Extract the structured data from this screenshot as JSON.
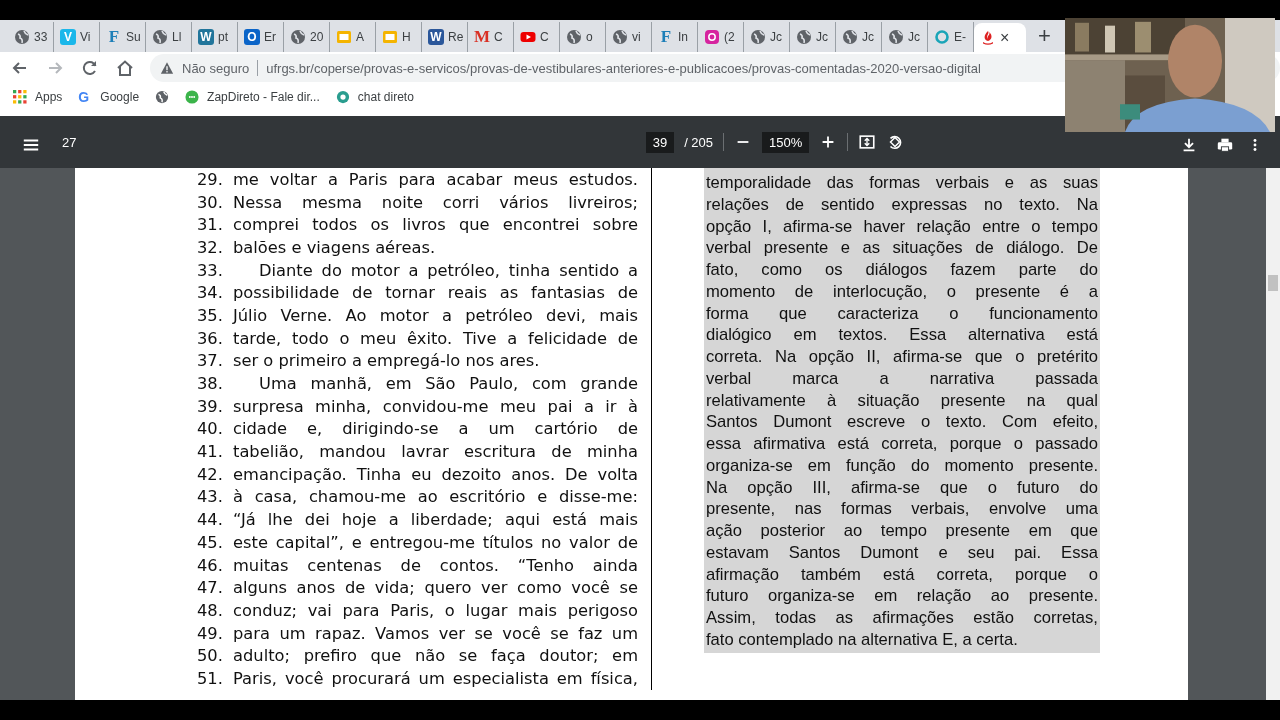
{
  "tabs": [
    {
      "kind": "globe",
      "title": "33",
      "selected": false
    },
    {
      "kind": "badge",
      "glyph": "V",
      "color": "#1ab7ea",
      "title": "Vi",
      "selected": false
    },
    {
      "kind": "letter",
      "glyph": "F",
      "color": "#1d7fb8",
      "title": "Su",
      "selected": false
    },
    {
      "kind": "globe",
      "title": "Ll",
      "selected": false
    },
    {
      "kind": "badge",
      "glyph": "W",
      "color": "#21759b",
      "title": "pt",
      "selected": false
    },
    {
      "kind": "badge",
      "glyph": "O",
      "color": "#0a64c8",
      "title": "Er",
      "selected": false
    },
    {
      "kind": "globe",
      "title": "20",
      "selected": false
    },
    {
      "kind": "slides",
      "title": "A",
      "selected": false
    },
    {
      "kind": "slides",
      "title": "H",
      "selected": false
    },
    {
      "kind": "badge",
      "glyph": "W",
      "color": "#2b579a",
      "title": "Re",
      "selected": false
    },
    {
      "kind": "letter",
      "glyph": "M",
      "color": "#d93025",
      "title": "C",
      "selected": false
    },
    {
      "kind": "youtube",
      "title": "C",
      "selected": false
    },
    {
      "kind": "globe",
      "title": "o",
      "selected": false
    },
    {
      "kind": "globe",
      "title": "vi",
      "selected": false
    },
    {
      "kind": "letter",
      "glyph": "F",
      "color": "#1d7fb8",
      "title": "In",
      "selected": false
    },
    {
      "kind": "instagram",
      "title": "(2",
      "selected": false
    },
    {
      "kind": "globe",
      "title": "Jc",
      "selected": false
    },
    {
      "kind": "globe",
      "title": "Jc",
      "selected": false
    },
    {
      "kind": "globe",
      "title": "Jc",
      "selected": false
    },
    {
      "kind": "globe",
      "title": "Jc",
      "selected": false
    },
    {
      "kind": "ring",
      "title": "E-",
      "selected": false
    },
    {
      "kind": "flame",
      "selected": true,
      "close": "×"
    }
  ],
  "new_tab": "+",
  "address": {
    "warning": "Não seguro",
    "url": "ufrgs.br/coperse/provas-e-servicos/provas-de-vestibulares-anteriores-e-publicacoes/provas-comentadas-2020-versao-digital"
  },
  "bookmarks": [
    {
      "kind": "apps",
      "label": "Apps"
    },
    {
      "kind": "google",
      "glyph": "G",
      "label": "Google"
    },
    {
      "kind": "globe"
    },
    {
      "kind": "zap",
      "label": "ZapDireto - Fale dir..."
    },
    {
      "kind": "chat",
      "label": "chat direto"
    }
  ],
  "pdf_toolbar": {
    "title": "27",
    "page": "39",
    "total": "/ 205",
    "zoom": "150%"
  },
  "left_column": [
    {
      "n": "29.",
      "text": "me voltar a Paris para acabar meus estudos.",
      "kind": "full"
    },
    {
      "n": "30.",
      "text": "Nessa mesma noite corri vários livreiros;",
      "kind": "full"
    },
    {
      "n": "31.",
      "text": "comprei todos os livros que encontrei sobre",
      "kind": "full"
    },
    {
      "n": "32.",
      "text": "balões e viagens aéreas.",
      "kind": "end"
    },
    {
      "n": "33.",
      "text": "Diante do motor a petróleo, tinha sentido a",
      "kind": "start"
    },
    {
      "n": "34.",
      "text": "possibilidade de tornar reais as fantasias de",
      "kind": "full"
    },
    {
      "n": "35.",
      "text": "Júlio Verne. Ao motor a petróleo devi, mais",
      "kind": "full"
    },
    {
      "n": "36.",
      "text": "tarde, todo o meu êxito. Tive a felicidade de",
      "kind": "full"
    },
    {
      "n": "37.",
      "text": "ser o primeiro a empregá-lo nos ares.",
      "kind": "end"
    },
    {
      "n": "38.",
      "text": "Uma manhã, em São Paulo, com grande",
      "kind": "start"
    },
    {
      "n": "39.",
      "text": "surpresa minha, convidou-me meu pai a ir à",
      "kind": "full"
    },
    {
      "n": "40.",
      "text": "cidade e, dirigindo-se a um cartório de",
      "kind": "full"
    },
    {
      "n": "41.",
      "text": "tabelião, mandou lavrar escritura de minha",
      "kind": "full"
    },
    {
      "n": "42.",
      "text": "emancipação. Tinha eu dezoito anos. De volta",
      "kind": "full"
    },
    {
      "n": "43.",
      "text": "à casa, chamou-me ao escritório e disse-me:",
      "kind": "full"
    },
    {
      "n": "44.",
      "text": "“Já lhe dei hoje a liberdade; aqui está mais",
      "kind": "full"
    },
    {
      "n": "45.",
      "text": "este capital”, e entregou-me títulos no valor de",
      "kind": "full"
    },
    {
      "n": "46.",
      "text": "muitas centenas de contos. “Tenho ainda",
      "kind": "full"
    },
    {
      "n": "47.",
      "text": "alguns anos de vida; quero ver como você se",
      "kind": "full"
    },
    {
      "n": "48.",
      "text": "conduz; vai para Paris, o lugar mais perigoso",
      "kind": "full"
    },
    {
      "n": "49.",
      "text": "para um rapaz. Vamos ver se você se faz um",
      "kind": "full"
    },
    {
      "n": "50.",
      "text": "adulto; prefiro que não se faça doutor; em",
      "kind": "full"
    },
    {
      "n": "51.",
      "text": "Paris, você procurará um especialista em física,",
      "kind": "full"
    }
  ],
  "right_column": [
    {
      "text": "temporalidade das formas verbais e as suas",
      "kind": "full"
    },
    {
      "text": "relações de sentido expressas no texto. Na",
      "kind": "full"
    },
    {
      "text": "opção I, afirma-se haver relação entre o tempo",
      "kind": "full"
    },
    {
      "text": "verbal presente e as situações de diálogo. De",
      "kind": "full"
    },
    {
      "text": "fato, como os diálogos fazem parte do",
      "kind": "full"
    },
    {
      "text": "momento de interlocução, o presente é a",
      "kind": "full"
    },
    {
      "text": "forma que caracteriza o funcionamento",
      "kind": "full"
    },
    {
      "text": "dialógico em textos. Essa alternativa está",
      "kind": "full"
    },
    {
      "text": "correta. Na opção II, afirma-se que o pretérito",
      "kind": "full"
    },
    {
      "text": "verbal marca a narrativa passada",
      "kind": "full"
    },
    {
      "text": "relativamente à situação presente na qual",
      "kind": "full"
    },
    {
      "text": "Santos Dumont escreve o texto. Com efeito,",
      "kind": "full"
    },
    {
      "text": "essa afirmativa está correta, porque o passado",
      "kind": "full"
    },
    {
      "text": "organiza-se em função do momento presente.",
      "kind": "full"
    },
    {
      "text": "Na opção III, afirma-se que o futuro do",
      "kind": "full"
    },
    {
      "text": "presente, nas formas verbais, envolve uma",
      "kind": "full"
    },
    {
      "text": "ação posterior ao tempo presente em que",
      "kind": "full"
    },
    {
      "text": "estavam Santos Dumont e seu pai. Essa",
      "kind": "full"
    },
    {
      "text": "afirmação também está correta, porque o",
      "kind": "full"
    },
    {
      "text": "futuro organiza-se em relação ao presente.",
      "kind": "full"
    },
    {
      "text": "Assim, todas as afirmações estão corretas,",
      "kind": "full"
    },
    {
      "text": "fato contemplado na alternativa E, a certa.",
      "kind": "end"
    }
  ]
}
